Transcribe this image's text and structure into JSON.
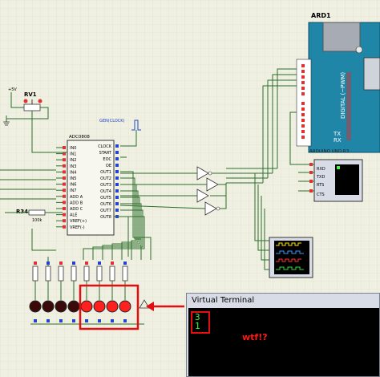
{
  "labels": {
    "ard1": "ARD1",
    "rv1": "RV1",
    "plus5v": "+5V",
    "r34": "R34",
    "r34_value": "100k",
    "adc_name": "ADC0808",
    "clock_gen": "GEN(CLOCK)",
    "arduino_name": "ARDUINO UNO R3",
    "digital": "DIGITAL (~PWM)",
    "tx": "TX",
    "rx": "RX"
  },
  "adc_pins_left": [
    "IN0",
    "IN1",
    "IN2",
    "IN3",
    "IN4",
    "IN5",
    "IN6",
    "IN7",
    "ADD A",
    "ADD B",
    "ADD C",
    "ALE",
    "VREF(+)",
    "VREF(-)"
  ],
  "adc_pins_right": [
    "CLOCK",
    "START",
    "EOC",
    "OE",
    "OUT1",
    "OUT2",
    "OUT3",
    "OUT4",
    "OUT5",
    "OUT6",
    "OUT7",
    "OUT8"
  ],
  "arduino_pins": [
    "AREF",
    "",
    "PB5/SCK",
    "PB4/MISO",
    "~PB3/MOSI/OC2A",
    "~PB2/SS/OC1B",
    "~PB1/OC1A",
    "PB0/ICP1/CLKO",
    "",
    "PD7/AIN1",
    "~PD6/AIN0",
    "~PD5/T1",
    "PD4/T0/XCK",
    "~PD3/INT1",
    "PD2/INT0",
    "TX PD1/TXD",
    "RX PD0/RXD"
  ],
  "vterm_pins": [
    "RXD",
    "TXD",
    "RTS",
    "CTS"
  ],
  "terminal": {
    "title": "Virtual Terminal",
    "lines": [
      "3",
      "1"
    ]
  },
  "annotation": "wtf!?",
  "colors": {
    "background": "#f0f0e2",
    "grid": "#dcdccc",
    "wire": "#2a6e2a",
    "highlight": "#e01010",
    "arduino": "#1f86a8"
  }
}
